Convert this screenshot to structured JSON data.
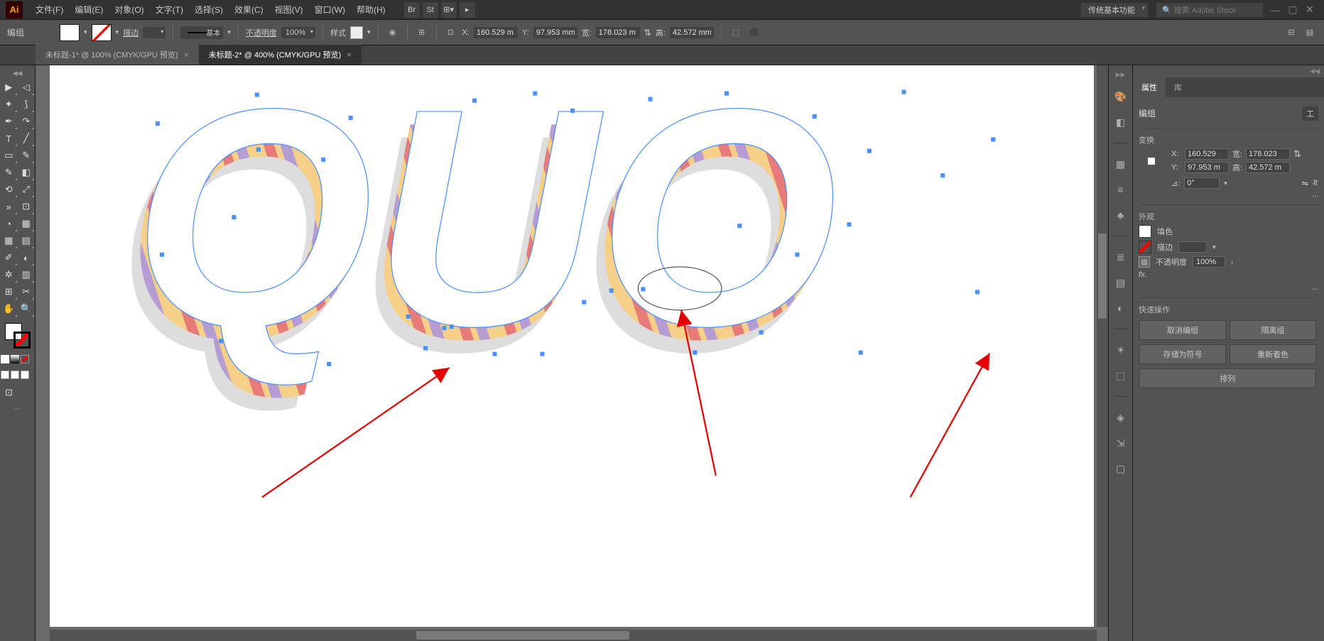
{
  "menubar": {
    "items": [
      "文件(F)",
      "编辑(E)",
      "对象(O)",
      "文字(T)",
      "选择(S)",
      "效果(C)",
      "视图(V)",
      "窗口(W)",
      "帮助(H)"
    ],
    "workspace": "传统基本功能",
    "search_placeholder": "搜索 Adobe Stock"
  },
  "controlbar": {
    "type_label": "编组",
    "stroke_label": "描边",
    "stroke_style": "基本",
    "opacity_label": "不透明度",
    "opacity_value": "100%",
    "style_label": "样式",
    "x_label": "X:",
    "x_value": "160.529 m",
    "y_label": "Y:",
    "y_value": "97.953 mm",
    "w_label": "宽:",
    "w_value": "178.023 m",
    "h_label": "高:",
    "h_value": "42.572 mm"
  },
  "tabs": [
    {
      "label": "未标题-1* @ 100% (CMYK/GPU 预览)",
      "active": false
    },
    {
      "label": "未标题-2* @ 400% (CMYK/GPU 预览)",
      "active": true
    }
  ],
  "properties": {
    "panel_tabs": [
      "属性",
      "库"
    ],
    "active_tab": 0,
    "object_type": "编组",
    "section_transform": "变换",
    "x_label": "X:",
    "x_value": "160.529",
    "y_label": "Y:",
    "y_value": "97.953 m",
    "w_label": "宽:",
    "w_value": "178.023",
    "h_label": "高:",
    "h_value": "42.572 m",
    "angle_label": "⊿:",
    "angle_value": "0°",
    "section_appearance": "外观",
    "fill_label": "填色",
    "stroke_label": "描边",
    "opacity_label": "不透明度",
    "opacity_value": "100%",
    "fx_label": "fx.",
    "section_quick": "快速操作",
    "btn_ungroup": "取消编组",
    "btn_isolate": "隔离组",
    "btn_save_symbol": "存储为符号",
    "btn_recolor": "重新着色",
    "btn_arrange": "排列",
    "more_label": "...",
    "tool_label": "工"
  },
  "toolbox_icons": [
    [
      "▶",
      "◁"
    ],
    [
      "✥",
      "✦"
    ],
    [
      "✒",
      "↗"
    ],
    [
      "T",
      "／"
    ],
    [
      "▭",
      "✎"
    ],
    [
      "◔",
      "⧉"
    ],
    [
      "⟋",
      "»"
    ],
    [
      "◐",
      "▦"
    ],
    [
      "⬚",
      "☒"
    ],
    [
      "◫",
      "▤"
    ],
    [
      "⊞",
      "⊡"
    ],
    [
      "✂",
      "≡"
    ],
    [
      "✥",
      "⟲"
    ],
    [
      "✋",
      "🔍"
    ]
  ],
  "dock_icons": [
    "◆",
    "⬛",
    "🅰",
    "≡",
    "⟐",
    "♣",
    "⧉",
    "≣",
    "☀",
    "◔",
    "◨",
    "⧉"
  ],
  "canvas_text": "QUO"
}
